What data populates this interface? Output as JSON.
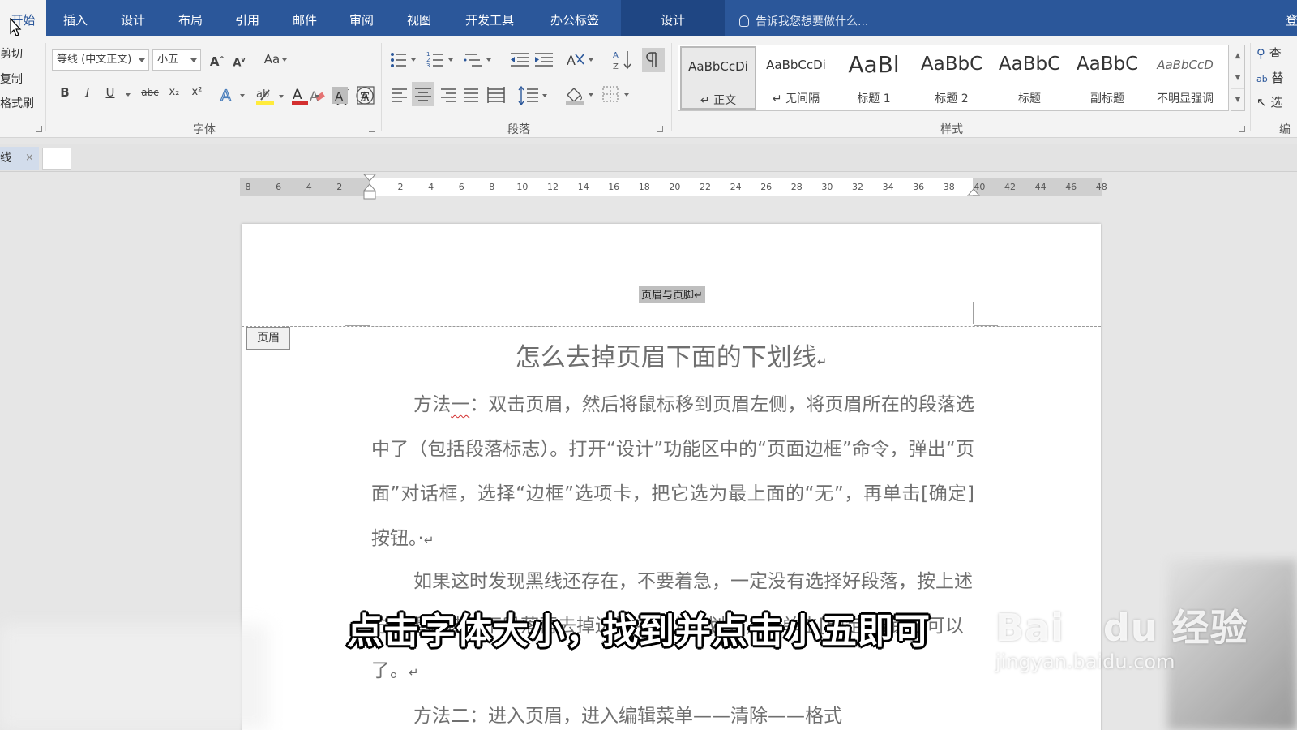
{
  "tabs": [
    {
      "label": "开始",
      "active": true
    },
    {
      "label": "插入"
    },
    {
      "label": "设计"
    },
    {
      "label": "布局"
    },
    {
      "label": "引用"
    },
    {
      "label": "邮件"
    },
    {
      "label": "审阅"
    },
    {
      "label": "视图"
    },
    {
      "label": "开发工具"
    },
    {
      "label": "办公标签"
    },
    {
      "label": "设计",
      "contextual": true
    }
  ],
  "tell_me": "告诉我您想要做什么...",
  "login": "登",
  "clipboard": {
    "cut": "剪切",
    "copy": "复制",
    "format_painter": "格式刷"
  },
  "font": {
    "name": "等线 (中文正文)",
    "size": "小五",
    "group_label": "字体",
    "change_case": "Aa",
    "bold": "B",
    "italic": "I",
    "underline": "U",
    "strike": "abc",
    "subscript": "x₂",
    "superscript": "x²"
  },
  "paragraph": {
    "group_label": "段落"
  },
  "styles": {
    "group_label": "样式",
    "items": [
      {
        "sample": "AaBbCcDi",
        "name": "正文",
        "selected": true
      },
      {
        "sample": "AaBbCcDi",
        "name": "无间隔"
      },
      {
        "sample": "AaBl",
        "name": "标题 1"
      },
      {
        "sample": "AaBbC",
        "name": "标题 2"
      },
      {
        "sample": "AaBbC",
        "name": "标题"
      },
      {
        "sample": "AaBbC",
        "name": "副标题"
      },
      {
        "sample": "AaBbCcD",
        "name": "不明显强调"
      }
    ]
  },
  "editing": {
    "find": "查",
    "replace": "替",
    "select": "选",
    "group_label": "编"
  },
  "doc_tab": {
    "label": "线",
    "close": "×"
  },
  "ruler_ticks": [
    "8",
    "6",
    "4",
    "2",
    "",
    "2",
    "4",
    "6",
    "8",
    "10",
    "12",
    "14",
    "16",
    "18",
    "20",
    "22",
    "24",
    "26",
    "28",
    "30",
    "32",
    "34",
    "36",
    "38",
    "40",
    "42",
    "44",
    "46",
    "48"
  ],
  "page": {
    "header_text": "页眉与页脚↵",
    "header_tag": "页眉",
    "title": "怎么去掉页眉下面的下划线",
    "p1_prefix": "方法",
    "p1_wavy": "一",
    "p1_rest": "：双击页眉，然后将鼠标移到页眉左侧，将页眉所在的段落选中了（包括段落标志）。打开“设计”功能区中的“页面边框”命令，弹出“页面”对话框，选择“边框”选项卡，把它选为最上面的“无”，再单击[确定]按钮。·",
    "p2": "如果这时发现黑线还存在，不要着急，一定没有选择好段落，按上述方法重新选一下段落再去掉边框中的上下划线，再单击[确定]按钮就可以了。",
    "p3": "方法二：进入页眉，进入编辑菜单——清除——格式",
    "pilcrow": "↵"
  },
  "subtitle": "点击字体大小，找到并点击小五即可",
  "watermark": {
    "main_left": "Bai",
    "main_right": "du",
    "main_cn": "经验",
    "url": "jingyan.baidu.com"
  },
  "colors": {
    "ribbon_blue": "#2b579a",
    "context_tab": "#1f4683",
    "font_red": "#d32f2f",
    "highlight_yellow": "#ffeb3b"
  }
}
